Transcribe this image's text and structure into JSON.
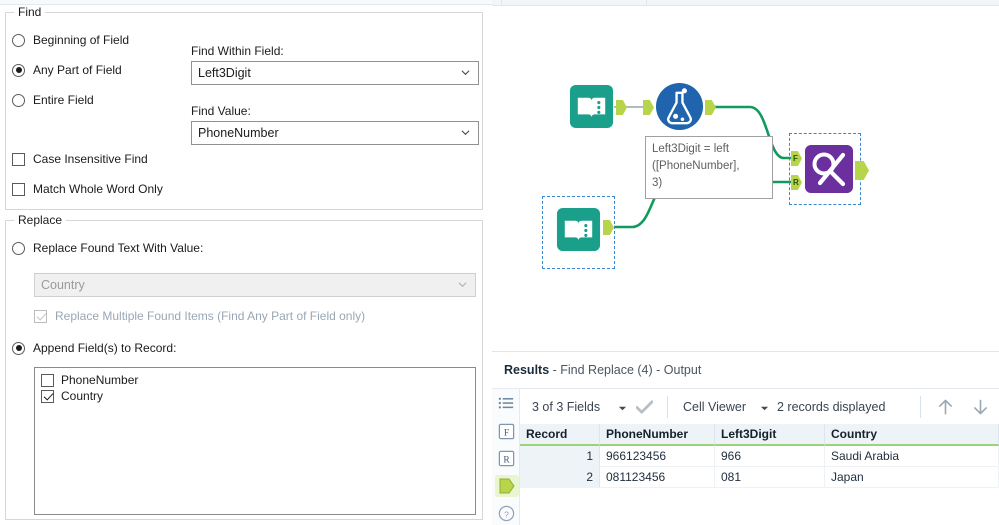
{
  "config": {
    "find_group": {
      "title": "Find",
      "radios": [
        {
          "label": "Beginning of Field",
          "selected": false
        },
        {
          "label": "Any Part of Field",
          "selected": true
        },
        {
          "label": "Entire Field",
          "selected": false
        }
      ],
      "checkboxes": [
        {
          "label": "Case Insensitive Find",
          "checked": false
        },
        {
          "label": "Match Whole Word Only",
          "checked": false
        }
      ],
      "find_within_field": {
        "label": "Find Within Field:",
        "value": "Left3Digit"
      },
      "find_value": {
        "label": "Find Value:",
        "value": "PhoneNumber"
      }
    },
    "replace_group": {
      "title": "Replace",
      "replace_found_text": {
        "label": "Replace Found Text With Value:",
        "selected": false
      },
      "replace_value_combo": {
        "value": "Country",
        "disabled": true
      },
      "replace_multiple": {
        "label": "Replace Multiple Found Items (Find Any Part of Field only)",
        "checked": true,
        "disabled": true
      },
      "append_fields": {
        "label": "Append Field(s) to Record:",
        "selected": true
      },
      "field_list": [
        {
          "label": "PhoneNumber",
          "checked": false
        },
        {
          "label": "Country",
          "checked": true
        }
      ]
    }
  },
  "canvas": {
    "annotation": "Left3Digit = left\n([PhoneNumber],\n3)",
    "nodes": [
      {
        "name": "input-data-tool-1",
        "type": "input-data",
        "selected": false
      },
      {
        "name": "formula-tool",
        "type": "formula",
        "selected": false
      },
      {
        "name": "find-replace-tool",
        "type": "find-replace",
        "selected": true
      },
      {
        "name": "input-data-tool-2",
        "type": "input-data",
        "selected": true
      }
    ],
    "anchor_labels": {
      "find": "F",
      "replace": "R"
    },
    "colors": {
      "input_tool": "#1aa08a",
      "formula_tool": "#1f64ad",
      "find_replace_tool": "#6b2f9e",
      "anchor": "#b7d44a",
      "connection": "#129a5e",
      "selection": "#3a87d0"
    }
  },
  "results": {
    "title_bold": "Results",
    "title_rest": " - Find Replace (4) - Output",
    "toolbar": {
      "fields_selector": "3 of 3 Fields",
      "check_icon": "check-icon",
      "view_mode": "Cell Viewer",
      "records_displayed": "2 records displayed",
      "nav_up": "arrow-up-icon",
      "nav_down": "arrow-down-icon"
    },
    "rail_icons": [
      "list-icon",
      "fields-icon",
      "records-icon",
      "output-anchor-icon",
      "help-icon"
    ],
    "table": {
      "columns": [
        "Record",
        "PhoneNumber",
        "Left3Digit",
        "Country"
      ],
      "rows": [
        [
          "1",
          "966123456",
          "966",
          "Saudi Arabia"
        ],
        [
          "2",
          "081123456",
          "081",
          "Japan"
        ]
      ]
    }
  }
}
